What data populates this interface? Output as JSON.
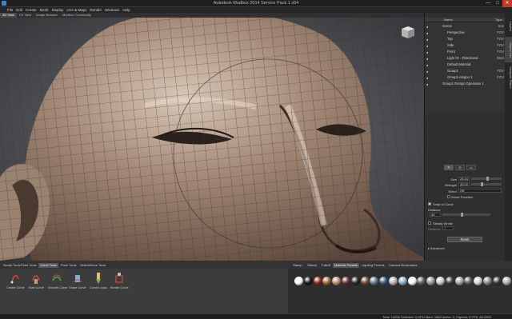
{
  "window": {
    "title": "Autodesk Mudbox 2014 Service Pack 1 x64",
    "minimize": "—",
    "maximize": "□",
    "close": "✕"
  },
  "menu": [
    "File",
    "Edit",
    "Create",
    "Mesh",
    "Display",
    "UVs & Maps",
    "Render",
    "Windows",
    "Help"
  ],
  "view_tabs": [
    "3D View",
    "UV View",
    "Image Browser",
    "Mudbox Community"
  ],
  "outliner": {
    "header": {
      "name": "Name",
      "type": "Type"
    },
    "rows": [
      {
        "name": "Scene",
        "type": "Sce"
      },
      {
        "name": "Perspective",
        "type": "FOV"
      },
      {
        "name": "Top",
        "type": "FOV"
      },
      {
        "name": "Side",
        "type": "FOV"
      },
      {
        "name": "Front",
        "type": "FOV"
      },
      {
        "name": "Light 01 - Directional",
        "type": "Inten"
      },
      {
        "name": "Default Material",
        "type": ""
      },
      {
        "name": "Group1",
        "type": "FOV"
      },
      {
        "name": "Group1-elogoo 1",
        "type": "FOV"
      },
      {
        "name": "Group1 Retopo Operation 1",
        "type": ""
      }
    ]
  },
  "side_tabs": [
    "Layers",
    "Object List",
    "Viewport Filters"
  ],
  "properties": {
    "size_label": "Size",
    "size_value": "28.34",
    "size_level": 0.55,
    "strength_label": "Strength",
    "strength_value": "35.00",
    "strength_level": 0.35,
    "mirror_label": "Mirror",
    "mirror_value": "Off",
    "smart_label": "Smart Function",
    "snap_label": "Snap to Curve",
    "distance_label": "Distance",
    "distance_value": "40",
    "distance_level": 0.4,
    "steady_label": "Steady Stroke",
    "steady_distance_label": "Distance",
    "steady_distance_value": "2",
    "reset_label": "Reset",
    "advanced_label": "Advanced"
  },
  "tool_tabs": [
    "Sculpt Tools",
    "Paint Tools",
    "Curve Tools",
    "Pose Tools",
    "Select/Move Tools"
  ],
  "tools": [
    "Create Curve",
    "Grab Curve",
    "Smooth Curve",
    "Erase Curve",
    "Curve Loops",
    "Border Curve"
  ],
  "material_tabs": [
    "Stamp",
    "Stencil",
    "Falloff",
    "Material Presets",
    "Lighting Presets",
    "Camera Bookmarks"
  ],
  "material_colors": [
    "#ffffff",
    "#1a1a1a",
    "#8a2a20",
    "#a06a40",
    "#c09070",
    "#5a3a30",
    "#2a2a2a",
    "#7a4a3a",
    "#6a7888",
    "#3c5a7a",
    "#b8b8b8",
    "#8ab0d0",
    "#ffffff",
    "#606060",
    "#9a9a9a",
    "#c8c8c8",
    "#404040",
    "#a8a8a8",
    "#5a5a5a",
    "#d6d6d6",
    "#888888",
    "#3a3a3a",
    "#b0b0b0"
  ],
  "status": "Total: 10056  Selected: 0  GPU Mem: 1882  Active: 0, Highest: 0  FPS: 85.0390",
  "accent": "#3d86c6"
}
